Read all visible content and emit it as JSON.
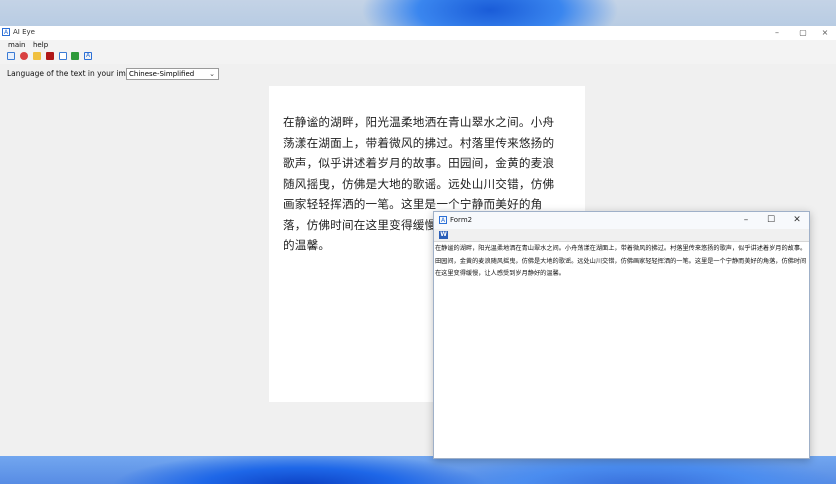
{
  "main_window": {
    "title": "AI Eye",
    "app_icon": "A",
    "menu": [
      "main",
      "help"
    ],
    "toolbar_icons": [
      "image-icon",
      "camera-icon",
      "folder-icon",
      "pdf-icon",
      "scan-icon",
      "export-icon",
      "ocr-icon"
    ],
    "language_label": "Language of the text in your image:",
    "language_value": "Chinese-Simplified",
    "document_text": "在静谧的湖畔，阳光温柔地洒在青山翠水之间。小舟荡漾在湖面上，带着微风的拂过。村落里传来悠扬的歌声，似乎讲述着岁月的故事。田园间，金黄的麦浪随风摇曳，仿佛是大地的歌谣。远处山川交错，仿佛画家轻轻挥洒的一笔。这里是一个宁静而美好的角落，仿佛时间在这里变得缓慢，让人感受到岁月静好的温馨。",
    "controls": {
      "minimize": "–",
      "maximize": "▢",
      "close": "×"
    }
  },
  "form2": {
    "title": "Form2",
    "app_icon": "A",
    "toolbar_icon": "W",
    "output_text": "在静谧的湖畔，阳光温柔地洒在青山翠水之间。小舟荡漾在湖面上，带着微风的拂过。村落里传来悠扬的歌声，似乎讲述着岁月的故事。田园间，金黄的麦浪随风摇曳，仿佛是大地的歌谣。远处山川交错，仿佛画家轻轻挥洒的一笔。这里是一个宁静而美好的角落，仿佛时间在这里变得缓慢，让人感受到岁月静好的温馨。",
    "controls": {
      "minimize": "–",
      "maximize": "☐",
      "close": "✕"
    }
  },
  "colors": {
    "accent": "#2b6fd6",
    "window_bg": "#f0f0f0",
    "word_blue": "#2b5fb8"
  }
}
